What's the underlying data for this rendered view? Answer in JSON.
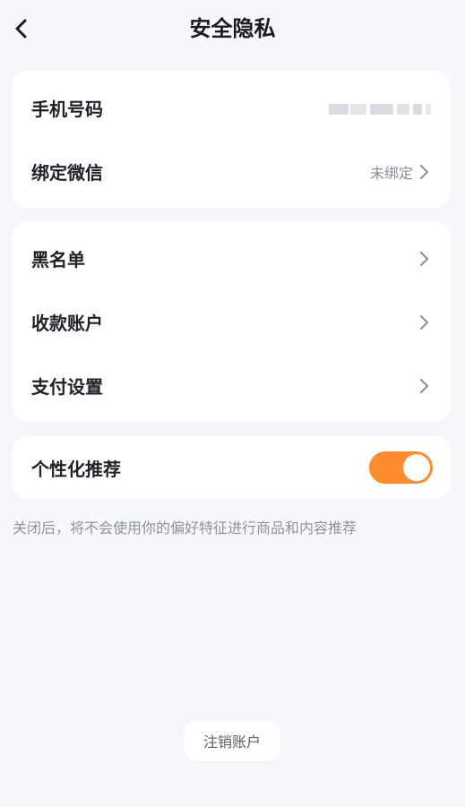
{
  "header": {
    "back_icon": "chevron-left-icon",
    "title": "安全隐私"
  },
  "account_card": {
    "phone_label": "手机号码",
    "phone_value_masked": true,
    "wechat_label": "绑定微信",
    "wechat_status": "未绑定"
  },
  "settings_card": {
    "items": [
      {
        "label": "黑名单"
      },
      {
        "label": "收款账户"
      },
      {
        "label": "支付设置"
      }
    ]
  },
  "personalization": {
    "label": "个性化推荐",
    "enabled": true,
    "note": "关闭后，将不会使用你的偏好特征进行商品和内容推荐"
  },
  "footer": {
    "logout_label": "注销账户"
  },
  "colors": {
    "background": "#f6f7fb",
    "card": "#ffffff",
    "toggle_on": "#ff8b2c",
    "muted_text": "#8f929b"
  }
}
